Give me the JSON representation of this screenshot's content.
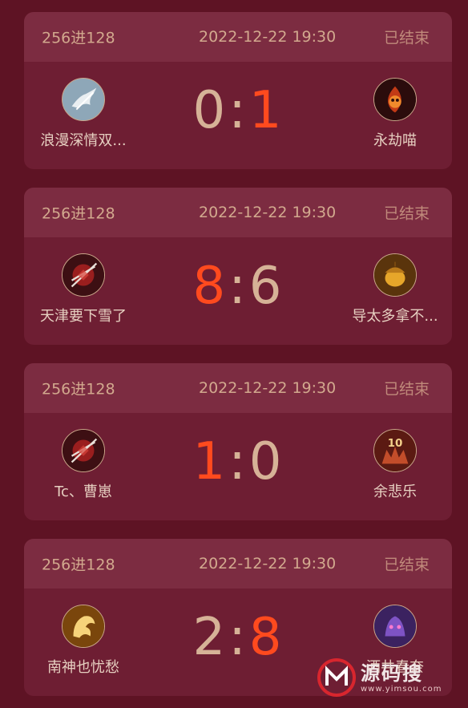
{
  "matches": [
    {
      "round": "256进128",
      "time": "2022-12-22 19:30",
      "status": "已结束",
      "left_team": {
        "name": "浪漫深情双...",
        "icon": "ink-warrior-icon"
      },
      "right_team": {
        "name": "永劫喵",
        "icon": "fire-mask-icon"
      },
      "score_left": "0",
      "score_right": "1",
      "winner": "right"
    },
    {
      "round": "256进128",
      "time": "2022-12-22 19:30",
      "status": "已结束",
      "left_team": {
        "name": "天津要下雪了",
        "icon": "swords-crest-icon"
      },
      "right_team": {
        "name": "导太多拿不...",
        "icon": "golden-acorn-icon"
      },
      "score_left": "8",
      "score_right": "6",
      "winner": "left"
    },
    {
      "round": "256进128",
      "time": "2022-12-22 19:30",
      "status": "已结束",
      "left_team": {
        "name": "Tc、曹崽",
        "icon": "swords-crest-icon"
      },
      "right_team": {
        "name": "余悲乐",
        "icon": "badge-10-icon",
        "badge_text": "10"
      },
      "score_left": "1",
      "score_right": "0",
      "winner": "left"
    },
    {
      "round": "256进128",
      "time": "2022-12-22 19:30",
      "status": "已结束",
      "left_team": {
        "name": "南神也忧愁",
        "icon": "golden-dragon-icon"
      },
      "right_team": {
        "name": "酒井春奈",
        "icon": "purple-demon-icon"
      },
      "score_left": "2",
      "score_right": "8",
      "winner": "right"
    }
  ],
  "watermark": {
    "main": "源码搜",
    "url": "www.yimsou.com",
    "icon": "logo-m-icon"
  },
  "colors": {
    "background": "#5e1324",
    "card": "#6e1e33",
    "card_header": "#7c2c41",
    "winner": "#ff4a1e",
    "score": "#d6b297"
  }
}
